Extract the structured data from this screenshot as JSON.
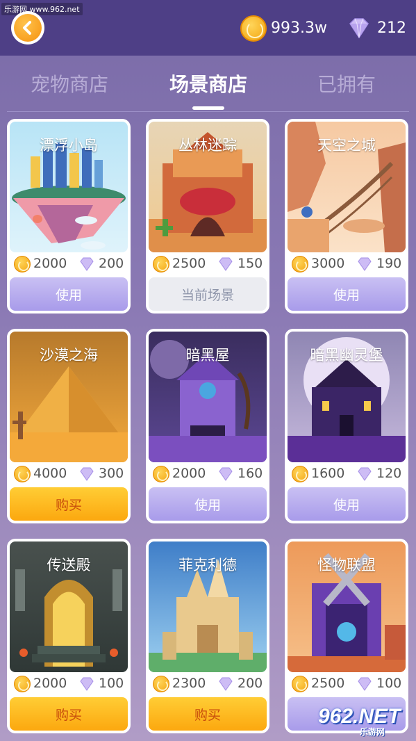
{
  "header": {
    "watermark": "乐游网 www.962.net",
    "coins": "993.3w",
    "diamonds": "212"
  },
  "tabs": [
    {
      "label": "宠物商店",
      "active": false
    },
    {
      "label": "场景商店",
      "active": true
    },
    {
      "label": "已拥有",
      "active": false
    }
  ],
  "scenes": [
    {
      "name": "漂浮小岛",
      "coin": "2000",
      "diamond": "200",
      "button": "使用",
      "state": "use"
    },
    {
      "name": "丛林迷踪",
      "coin": "2500",
      "diamond": "150",
      "button": "当前场景",
      "state": "current"
    },
    {
      "name": "天空之城",
      "coin": "3000",
      "diamond": "190",
      "button": "使用",
      "state": "use"
    },
    {
      "name": "沙漠之海",
      "coin": "4000",
      "diamond": "300",
      "button": "购买",
      "state": "buy"
    },
    {
      "name": "暗黑屋",
      "coin": "2000",
      "diamond": "160",
      "button": "使用",
      "state": "use"
    },
    {
      "name": "暗黑幽灵堡",
      "coin": "1600",
      "diamond": "120",
      "button": "使用",
      "state": "use"
    },
    {
      "name": "传送殿",
      "coin": "2000",
      "diamond": "100",
      "button": "购买",
      "state": "buy"
    },
    {
      "name": "菲克利德",
      "coin": "2300",
      "diamond": "200",
      "button": "购买",
      "state": "buy"
    },
    {
      "name": "怪物联盟",
      "coin": "2500",
      "diamond": "100",
      "button": "",
      "state": "use"
    }
  ],
  "watermark_bottom": {
    "main": "962.NET",
    "sub": "乐游网"
  },
  "colors": {
    "topbar": "#4e3f86",
    "use": "#a89bea",
    "buy": "#fca80f",
    "current": "#ebecf1"
  }
}
